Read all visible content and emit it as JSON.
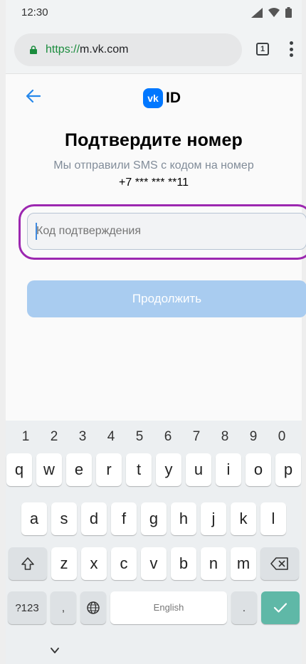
{
  "status_bar": {
    "time": "12:30"
  },
  "browser": {
    "url_scheme": "https://",
    "url_host": "m.vk.com",
    "tab_count": "1"
  },
  "header": {
    "logo_badge": "vk",
    "logo_text": "ID"
  },
  "page": {
    "title": "Подтвердите номер",
    "subtitle": "Мы отправили SMS с кодом на номер",
    "phone_masked": "+7 *** *** **11",
    "code_placeholder": "Код подтверждения",
    "continue_label": "Продолжить"
  },
  "keyboard": {
    "numbers": [
      "1",
      "2",
      "3",
      "4",
      "5",
      "6",
      "7",
      "8",
      "9",
      "0"
    ],
    "row1": [
      "q",
      "w",
      "e",
      "r",
      "t",
      "y",
      "u",
      "i",
      "o",
      "p"
    ],
    "row2": [
      "a",
      "s",
      "d",
      "f",
      "g",
      "h",
      "j",
      "k",
      "l"
    ],
    "row3": [
      "z",
      "x",
      "c",
      "v",
      "b",
      "n",
      "m"
    ],
    "symbols_label": "?123",
    "comma_label": ",",
    "space_label": "English",
    "period_label": "."
  },
  "colors": {
    "vk_blue": "#0077ff",
    "highlight_purple": "#9c27b0",
    "button_disabled": "#a9ccf0",
    "enter_key": "#5fb8a7"
  }
}
